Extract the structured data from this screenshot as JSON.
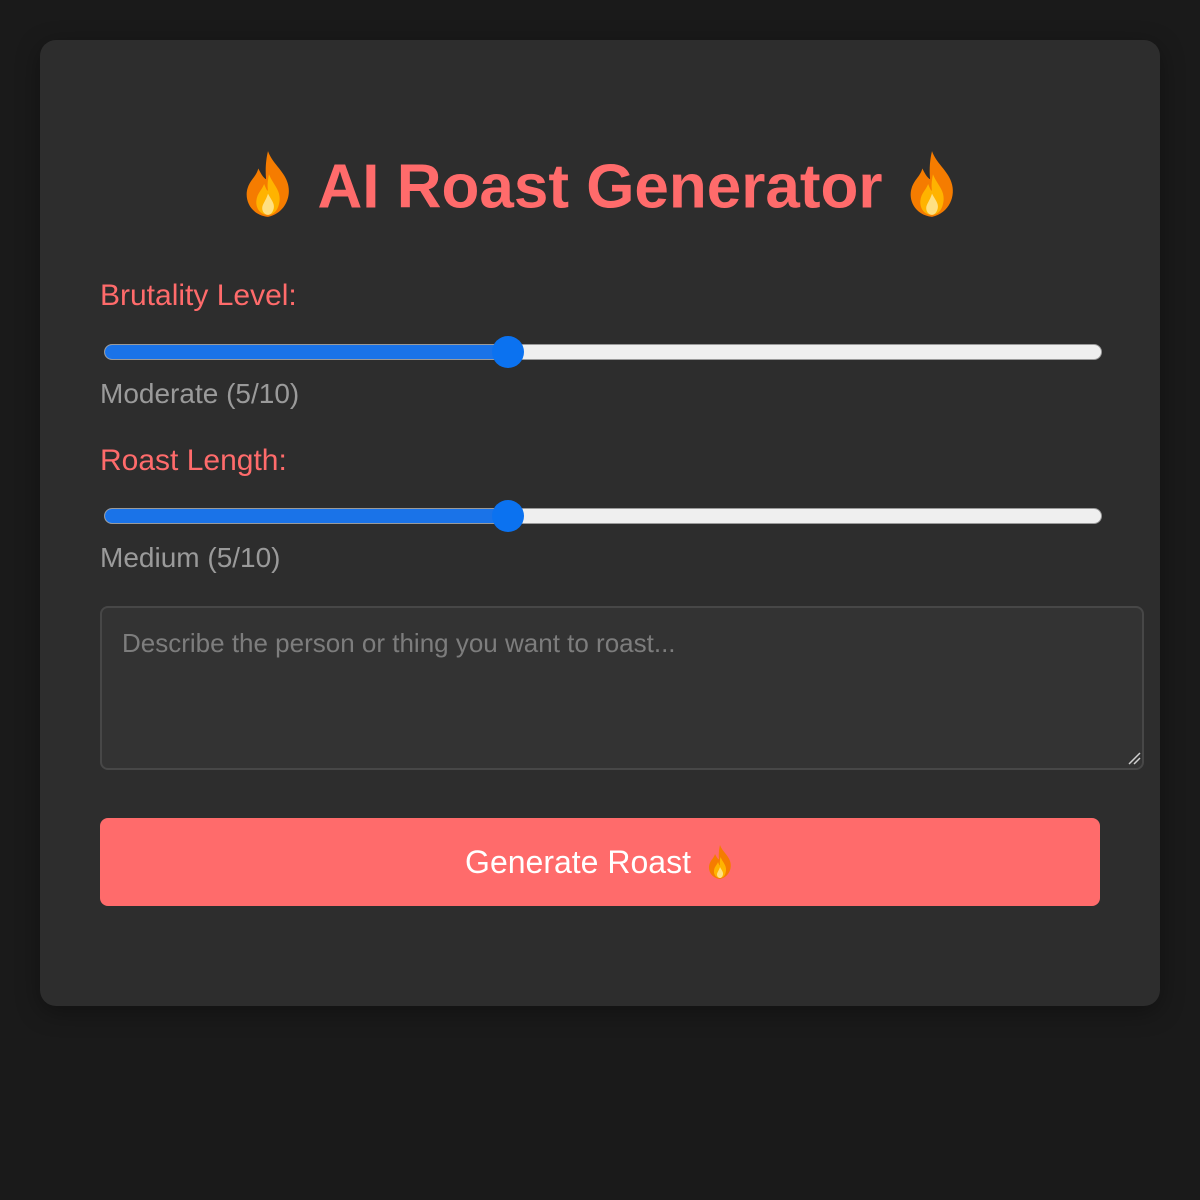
{
  "app": {
    "title": "AI Roast Generator",
    "title_icon": "fire-icon"
  },
  "brutality": {
    "label": "Brutality Level:",
    "value": 5,
    "min": 1,
    "max": 10,
    "value_text": "Moderate (5/10)"
  },
  "length": {
    "label": "Roast Length:",
    "value": 5,
    "min": 1,
    "max": 10,
    "value_text": "Medium (5/10)"
  },
  "description": {
    "placeholder": "Describe the person or thing you want to roast...",
    "value": ""
  },
  "generate": {
    "label": "Generate Roast",
    "icon": "fire-icon"
  },
  "colors": {
    "accent": "#ff6b6b",
    "slider_fill": "#1a73e8",
    "slider_thumb": "#0b72f0",
    "background": "#1a1a1a",
    "card": "#2d2d2d"
  }
}
